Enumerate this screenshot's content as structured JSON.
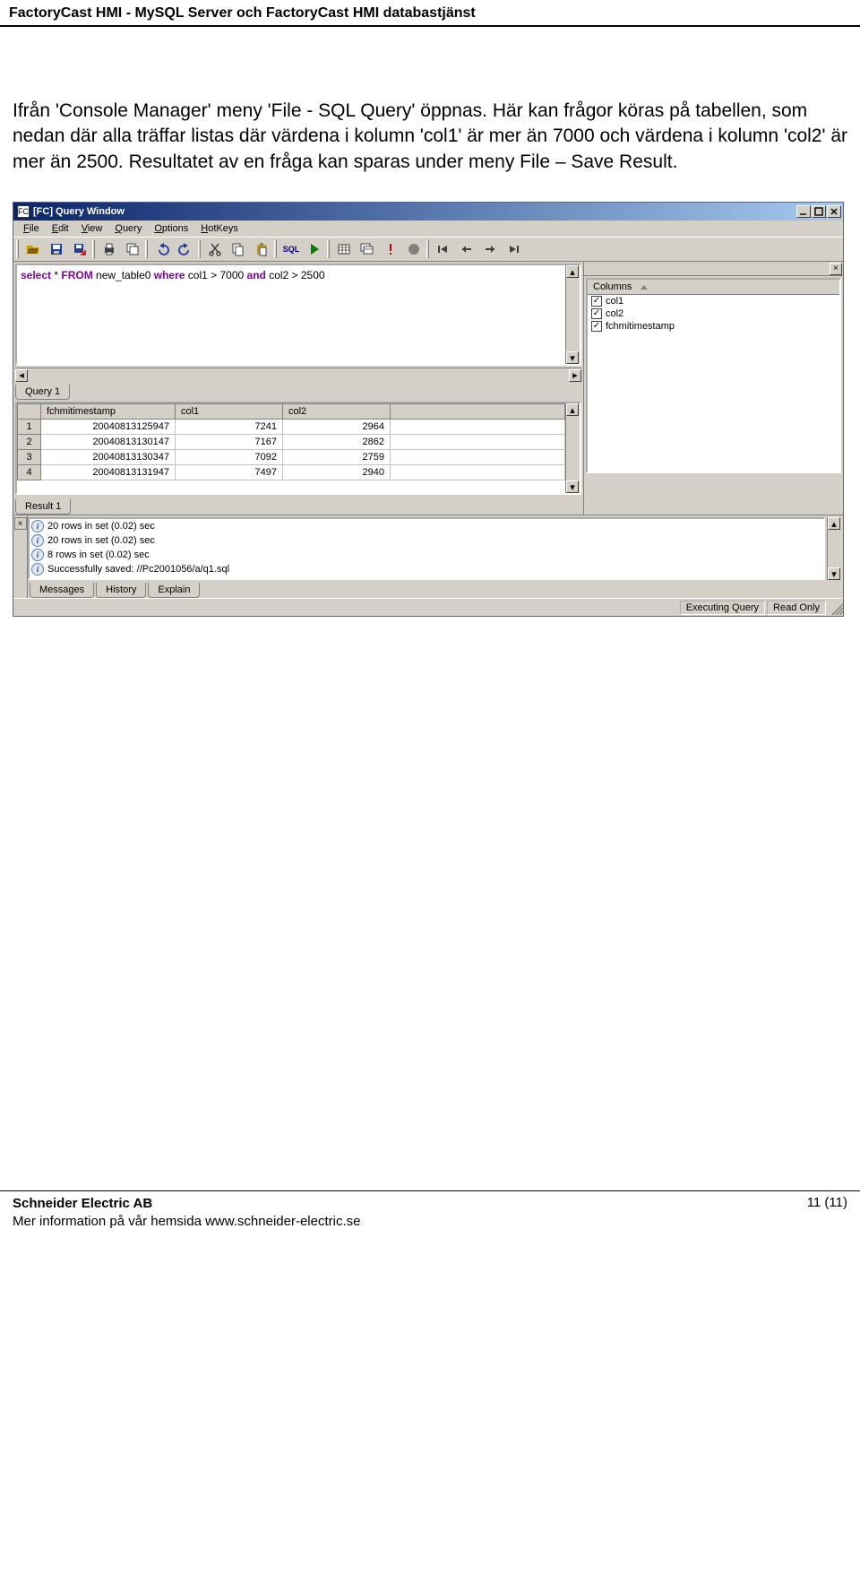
{
  "page_header": "FactoryCast HMI - MySQL Server och FactoryCast HMI databastjänst",
  "body_text": "Ifrån 'Console Manager' meny 'File - SQL Query' öppnas. Här kan frågor köras på tabellen, som nedan där alla träffar listas där värdena i kolumn 'col1' är mer än 7000 och värdena i kolumn 'col2' är mer än 2500. Resultatet av en fråga kan sparas under meny File – Save Result.",
  "window": {
    "title_prefix": "FC",
    "title": "[FC] Query Window",
    "menubar": [
      "File",
      "Edit",
      "View",
      "Query",
      "Options",
      "HotKeys"
    ],
    "toolbar_icons": [
      "open",
      "save",
      "save-as",
      "sep",
      "undo",
      "redo",
      "sep",
      "find",
      "sep",
      "cut",
      "copy",
      "paste",
      "sep",
      "sql",
      "exec",
      "sep",
      "table",
      "table2",
      "exclaim",
      "stop",
      "sep",
      "row-first",
      "row-up",
      "row-down",
      "row-last"
    ],
    "query_tab": "Query 1",
    "query_tokens": [
      {
        "t": "select",
        "k": true
      },
      {
        "t": " * "
      },
      {
        "t": "FROM",
        "k": true
      },
      {
        "t": " new_table0 "
      },
      {
        "t": "where",
        "k": true
      },
      {
        "t": " col1 > 7000 "
      },
      {
        "t": "and",
        "k": true
      },
      {
        "t": " col2 > 2500"
      }
    ],
    "results": {
      "columns": [
        "fchmitimestamp",
        "col1",
        "col2"
      ],
      "rows": [
        {
          "n": "1",
          "cells": [
            "20040813125947",
            "7241",
            "2964"
          ]
        },
        {
          "n": "2",
          "cells": [
            "20040813130147",
            "7167",
            "2862"
          ]
        },
        {
          "n": "3",
          "cells": [
            "20040813130347",
            "7092",
            "2759"
          ]
        },
        {
          "n": "4",
          "cells": [
            "20040813131947",
            "7497",
            "2940"
          ]
        }
      ],
      "tab": "Result 1"
    },
    "columns_panel": {
      "header": "Columns",
      "items": [
        "col1",
        "col2",
        "fchmitimestamp"
      ]
    },
    "log": {
      "lines": [
        "20 rows in set (0.02) sec",
        "20 rows in set (0.02) sec",
        "8 rows in set (0.02) sec",
        "Successfully saved: //Pc2001056/a/q1.sql"
      ],
      "tabs": [
        "Messages",
        "History",
        "Explain"
      ]
    },
    "status": {
      "exec": "Executing Query",
      "ro": "Read Only"
    }
  },
  "footer": {
    "line1": "Schneider Electric AB",
    "line2": "Mer information på vår hemsida www.schneider-electric.se",
    "page": "11 (11)"
  }
}
